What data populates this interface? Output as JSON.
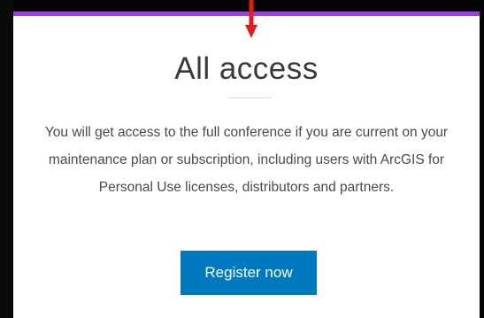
{
  "card": {
    "title": "All access",
    "description": "You will get access to the full conference if you are current on your maintenance plan or subscription, including users with ArcGIS for Personal Use licenses, distributors and partners.",
    "register_label": "Register now"
  },
  "colors": {
    "accent_border": "#a23be6",
    "button": "#0079c1",
    "annotation_arrow": "#e31b1b"
  }
}
